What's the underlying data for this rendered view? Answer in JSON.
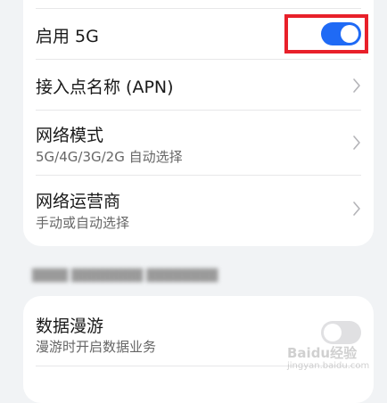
{
  "network_card": {
    "enable_5g": {
      "label": "启用 5G",
      "enabled": true
    },
    "apn": {
      "label": "接入点名称 (APN)"
    },
    "network_mode": {
      "label": "网络模式",
      "value": "5G/4G/3G/2G 自动选择"
    },
    "network_operator": {
      "label": "网络运营商",
      "value": "手动或自动选择"
    }
  },
  "roaming_card": {
    "data_roaming": {
      "label": "数据漫游",
      "description": "漫游时开启数据业务",
      "enabled": false
    }
  },
  "colors": {
    "accent": "#1f6af5",
    "highlight": "#e8202a",
    "background": "#f1f3f5"
  },
  "watermark": {
    "text": "Baidu经验",
    "sub": "jingyan.baidu.com"
  }
}
